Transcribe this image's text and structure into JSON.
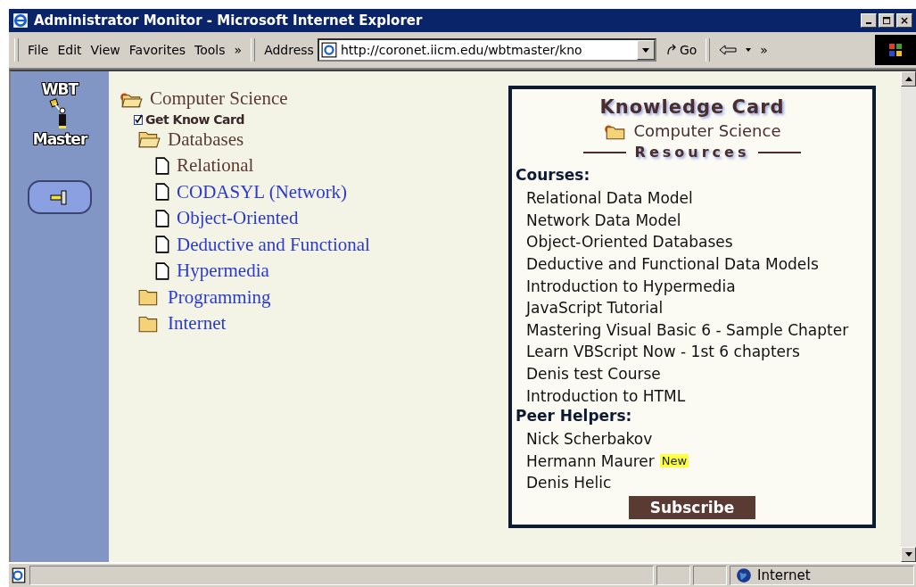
{
  "window": {
    "title": "Administrator Monitor - Microsoft Internet Explorer"
  },
  "menu": [
    "File",
    "Edit",
    "View",
    "Favorites",
    "Tools"
  ],
  "menu_more": "»",
  "address": {
    "label": "Address",
    "value": "http://coronet.iicm.edu/wbtmaster/kno"
  },
  "go": "Go",
  "toolbar_more": "»",
  "sidebar": {
    "logo_top": "WBT",
    "logo_bottom": "Master"
  },
  "tree": {
    "label": "Computer Science",
    "expanded": true,
    "action": "Get Know Card",
    "children": [
      {
        "kind": "folder",
        "label": "Databases",
        "expanded": true,
        "children": [
          {
            "kind": "page",
            "label": "Relational",
            "selected": true
          },
          {
            "kind": "page",
            "label": "CODASYL (Network)",
            "selected": false
          },
          {
            "kind": "page",
            "label": "Object-Oriented",
            "selected": false
          },
          {
            "kind": "page",
            "label": "Deductive and Functional",
            "selected": false
          },
          {
            "kind": "page",
            "label": "Hypermedia",
            "selected": false
          }
        ]
      },
      {
        "kind": "folder",
        "label": "Programming",
        "expanded": false
      },
      {
        "kind": "folder",
        "label": "Internet",
        "expanded": false
      }
    ]
  },
  "card": {
    "title": "Knowledge Card",
    "topic": "Computer Science",
    "section": "Resources",
    "groups": [
      {
        "heading": "Courses:",
        "items": [
          {
            "label": "Relational Data Model"
          },
          {
            "label": "Network Data Model"
          },
          {
            "label": "Object-Oriented Databases"
          },
          {
            "label": "Deductive and Functional Data Models"
          },
          {
            "label": "Introduction to Hypermedia"
          },
          {
            "label": "JavaScript Tutorial"
          },
          {
            "label": "Mastering Visual Basic 6 - Sample Chapter"
          },
          {
            "label": "Learn VBScript Now - 1st 6 chapters"
          },
          {
            "label": "Denis test Course"
          },
          {
            "label": "Introduction to HTML"
          }
        ]
      },
      {
        "heading": "Peer Helpers:",
        "items": [
          {
            "label": "Nick Scherbakov"
          },
          {
            "label": "Hermann Maurer",
            "badge": "New"
          },
          {
            "label": "Denis Helic"
          }
        ]
      }
    ],
    "button": "Subscribe"
  },
  "status_bar": {
    "zone": "Internet"
  }
}
